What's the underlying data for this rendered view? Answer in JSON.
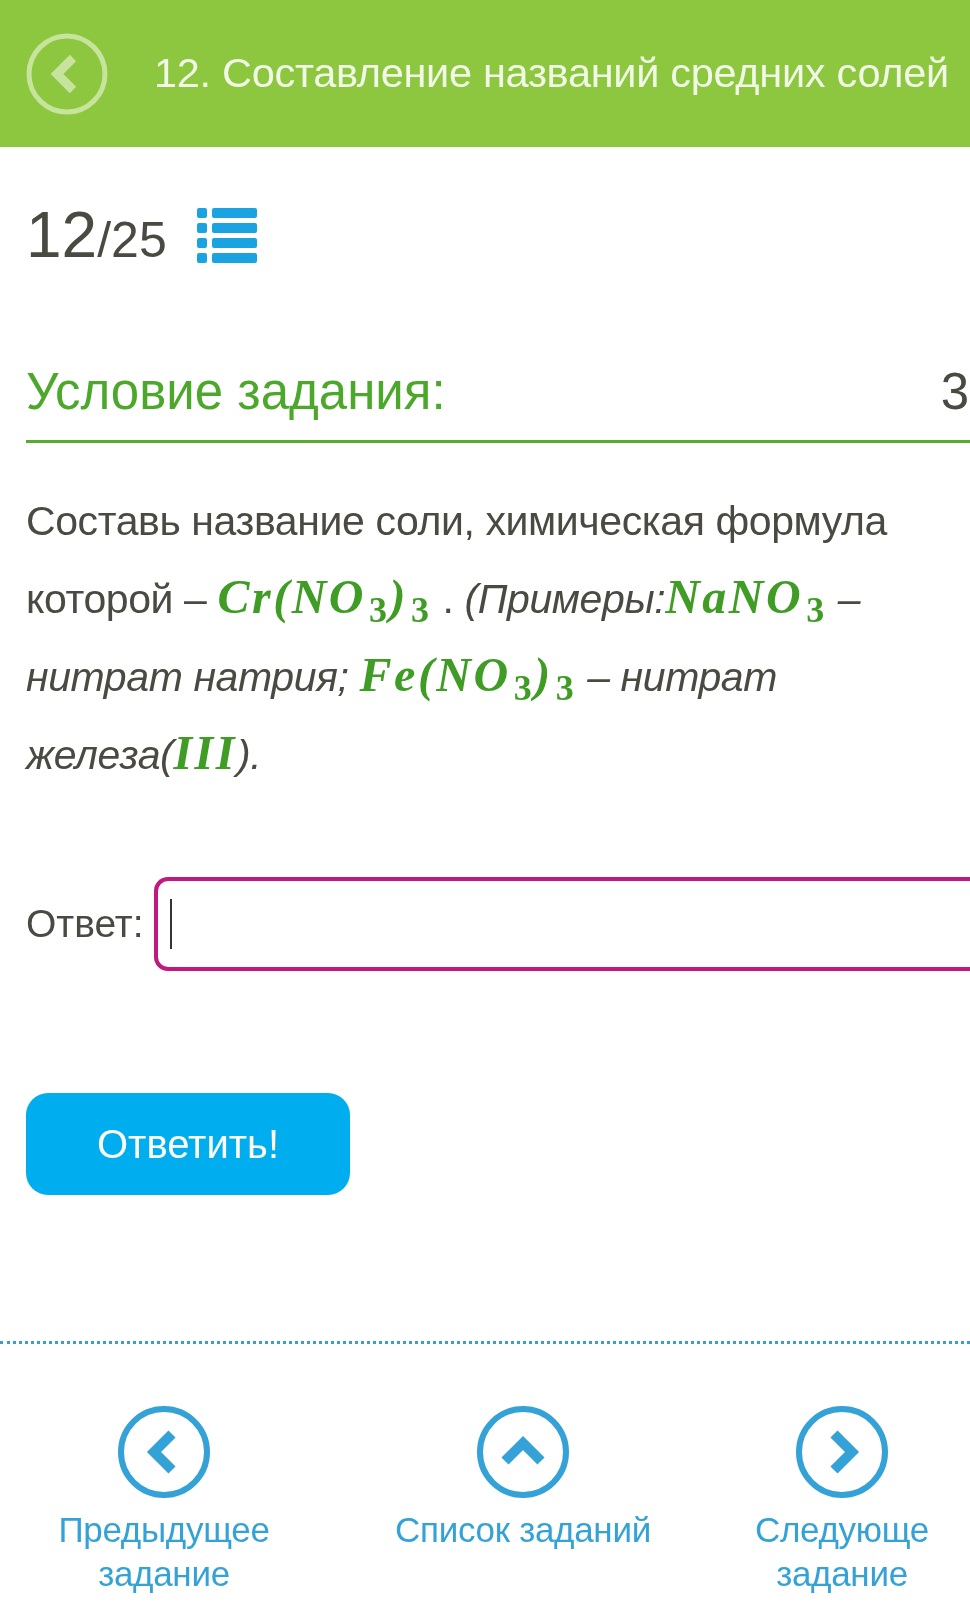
{
  "header": {
    "title": "12. Составление названий средних солей"
  },
  "progress": {
    "current": "12",
    "total": "/25"
  },
  "condition": {
    "heading": "Условие задания:",
    "points": "3",
    "lines": [
      [
        {
          "kind": "text",
          "text": "Составь название соли, химическая формула"
        }
      ],
      [
        {
          "kind": "text",
          "text": "которой – "
        },
        {
          "kind": "formula",
          "text": "Cr(NO$_{3}$)$_{3}$"
        },
        {
          "kind": "text",
          "text": " . "
        },
        {
          "kind": "italic",
          "text": "(Примеры:"
        },
        {
          "kind": "formula",
          "text": "NaNO$_{3}$"
        },
        {
          "kind": "italic",
          "text": " –"
        }
      ],
      [
        {
          "kind": "italic",
          "text": "нитрат натрия; "
        },
        {
          "kind": "formula",
          "text": "Fe(NO$_{3}$)$_{3}$"
        },
        {
          "kind": "italic",
          "text": " – нитрат"
        }
      ],
      [
        {
          "kind": "italic",
          "text": "железа("
        },
        {
          "kind": "formula",
          "text": "III"
        },
        {
          "kind": "italic",
          "text": ")."
        }
      ]
    ]
  },
  "answer": {
    "label": "Ответ:",
    "focused": true
  },
  "submit_button": {
    "label": "Ответить!"
  },
  "nav": [
    {
      "kind": "previous",
      "label": "Предыдущее задание"
    },
    {
      "kind": "list",
      "label": "Список заданий"
    },
    {
      "kind": "next",
      "label": "Следующе задание"
    }
  ]
}
